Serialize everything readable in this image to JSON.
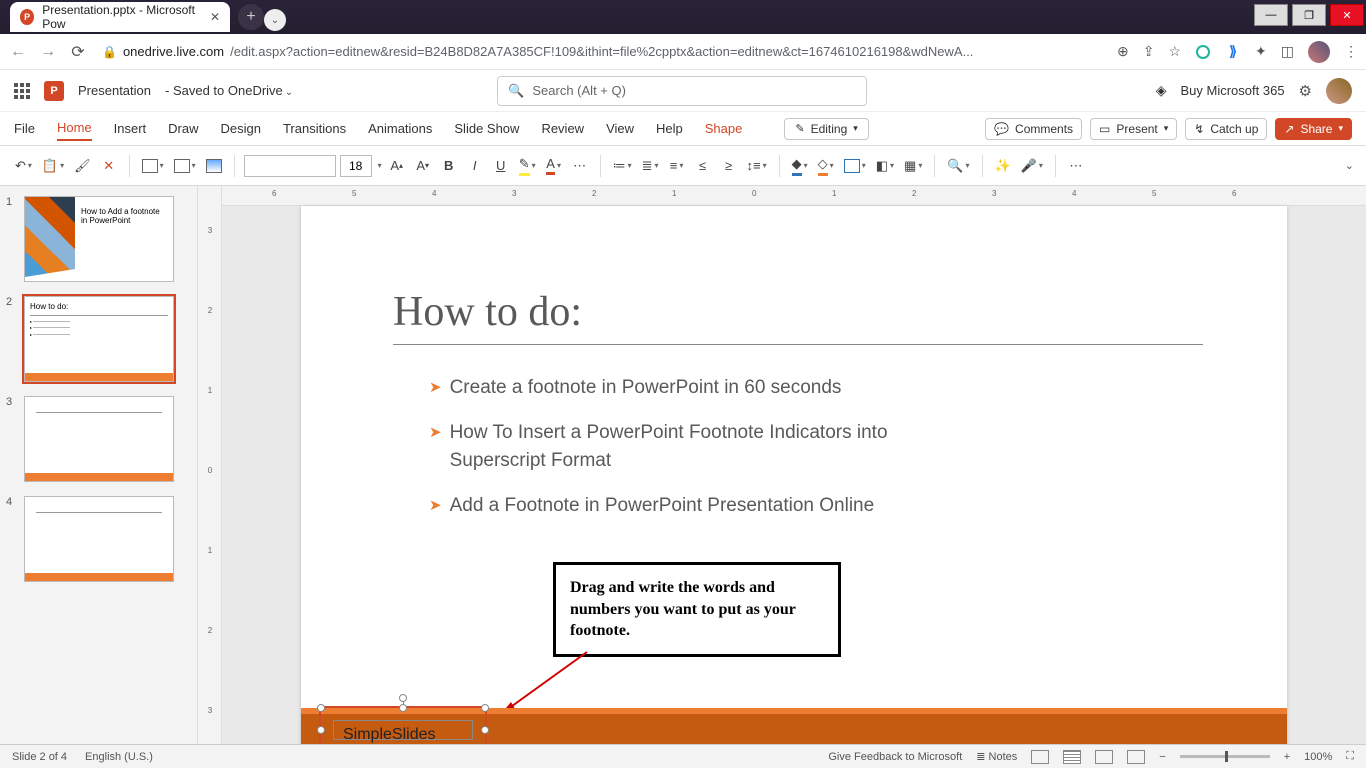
{
  "browser": {
    "tab_title": "Presentation.pptx - Microsoft Pow",
    "url_host": "onedrive.live.com",
    "url_path": "/edit.aspx?action=editnew&resid=B24B8D82A7A385CF!109&ithint=file%2cpptx&action=editnew&ct=1674610216198&wdNewA..."
  },
  "header": {
    "doc_name": "Presentation",
    "save_state": "Saved to OneDrive",
    "search_placeholder": "Search (Alt + Q)",
    "buy": "Buy Microsoft 365"
  },
  "menu": {
    "items": [
      "File",
      "Home",
      "Insert",
      "Draw",
      "Design",
      "Transitions",
      "Animations",
      "Slide Show",
      "Review",
      "View",
      "Help",
      "Shape"
    ],
    "active": "Home",
    "editing": "Editing",
    "comments": "Comments",
    "present": "Present",
    "catchup": "Catch up",
    "share": "Share"
  },
  "ribbon": {
    "font_size": "18"
  },
  "thumbs": {
    "t1_title": "How to Add a footnote in PowerPoint",
    "t2_title": "How to do:"
  },
  "slide": {
    "title": "How to do:",
    "bullets": [
      "Create a footnote in PowerPoint in 60 seconds",
      "How To Insert a PowerPoint Footnote Indicators into Superscript Format",
      "Add a Footnote in PowerPoint Presentation Online"
    ],
    "callout": "Drag and write the words and numbers you want to put as your footnote.",
    "footnote_text": "SimpleSlides"
  },
  "status": {
    "slide_info": "Slide 2 of 4",
    "lang": "English (U.S.)",
    "feedback": "Give Feedback to Microsoft",
    "notes": "Notes",
    "zoom": "100%"
  }
}
